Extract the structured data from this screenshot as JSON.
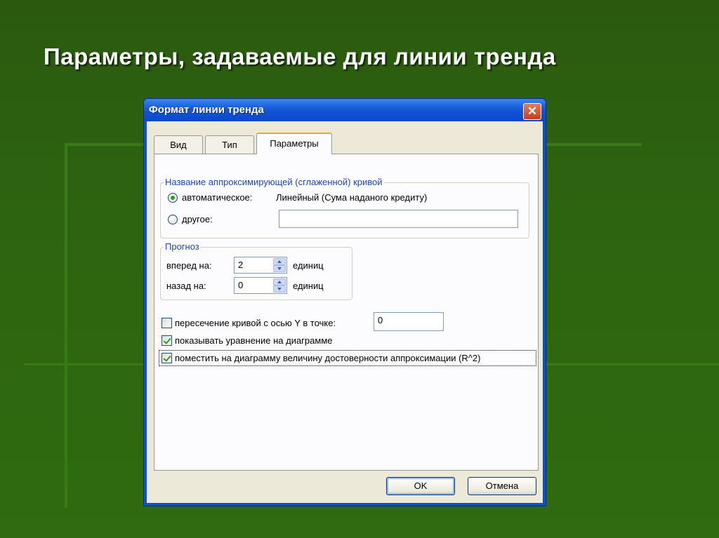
{
  "slide": {
    "title": "Параметры, задаваемые для линии тренда"
  },
  "dialog": {
    "title": "Формат линии тренда",
    "close_symbol": "✕",
    "tabs": [
      {
        "label": "Вид",
        "active": false
      },
      {
        "label": "Тип",
        "active": false
      },
      {
        "label": "Параметры",
        "active": true
      }
    ],
    "name_group": {
      "caption": "Название аппроксимирующей (сглаженной) кривой",
      "auto_label": "автоматическое:",
      "auto_value": "Линейный (Сума наданого кредиту)",
      "auto_selected": true,
      "custom_label": "другое:",
      "custom_value": ""
    },
    "forecast_group": {
      "caption": "Прогноз",
      "forward_label": "вперед на:",
      "forward_value": "2",
      "forward_unit": "единиц",
      "backward_label": "назад на:",
      "backward_value": "0",
      "backward_unit": "единиц"
    },
    "options": {
      "intercept_label": "пересечение кривой с осью Y в точке:",
      "intercept_checked": false,
      "intercept_value": "0",
      "show_equation_label": "показывать уравнение на диаграмме",
      "show_equation_checked": true,
      "show_r2_label": "поместить на диаграмму величину достоверности аппроксимации (R^2)",
      "show_r2_checked": true
    },
    "buttons": {
      "ok_label": "OK",
      "cancel_label": "Отмена"
    }
  },
  "colors": {
    "background": "#2a5c0d",
    "titlebar": "#0a47c9",
    "dialog_face": "#ece9d8",
    "group_caption": "#1e46b4",
    "check_green": "#21a121"
  }
}
